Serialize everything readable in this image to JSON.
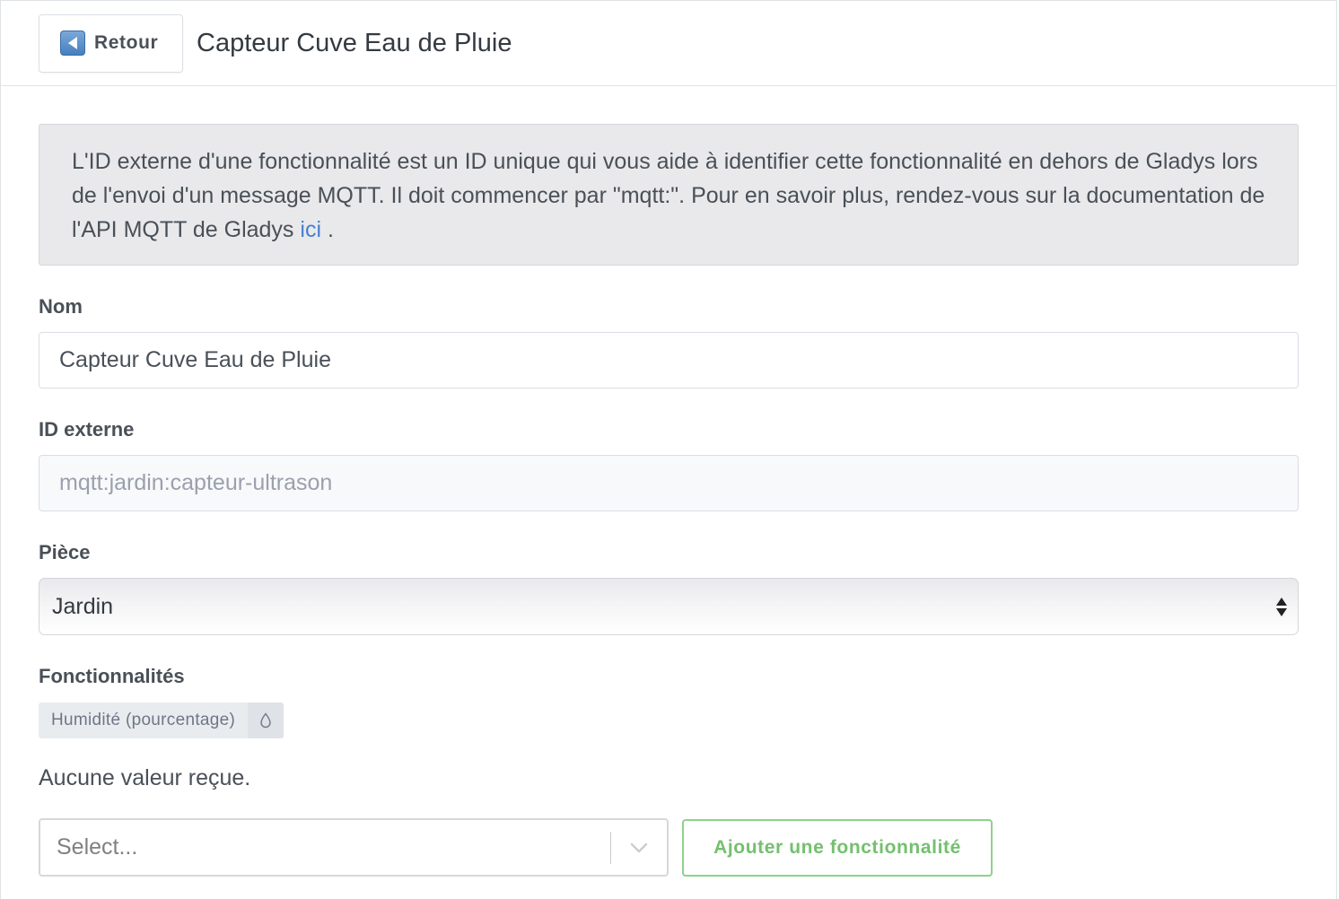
{
  "header": {
    "back_label": "Retour",
    "title": "Capteur Cuve Eau de Pluie",
    "back_icon": "arrow-left-icon"
  },
  "alert": {
    "text": "L'ID externe d'une fonctionnalité est un ID unique qui vous aide à identifier cette fonctionnalité en dehors de Gladys lors de l'envoi d'un message MQTT. Il doit commencer par \"mqtt:\". Pour en savoir plus, rendez-vous sur la documentation de l'API MQTT de Gladys",
    "link_text": "ici",
    "suffix": " ."
  },
  "form": {
    "name_label": "Nom",
    "name_value": "Capteur Cuve Eau de Pluie",
    "external_id_label": "ID externe",
    "external_id_value": "mqtt:jardin:capteur-ultrason",
    "room_label": "Pièce",
    "room_value": "Jardin",
    "features_label": "Fonctionnalités"
  },
  "feature_tag": {
    "label": "Humidité (pourcentage)",
    "icon": "droplet-icon"
  },
  "no_value_text": "Aucune valeur reçue.",
  "feature_select": {
    "placeholder": "Select...",
    "icon": "chevron-down-icon"
  },
  "add_button_label": "Ajouter une fonctionnalité",
  "colors": {
    "link": "#467fcf",
    "success": "#5eba00",
    "alert_bg": "#e9e9eb"
  }
}
